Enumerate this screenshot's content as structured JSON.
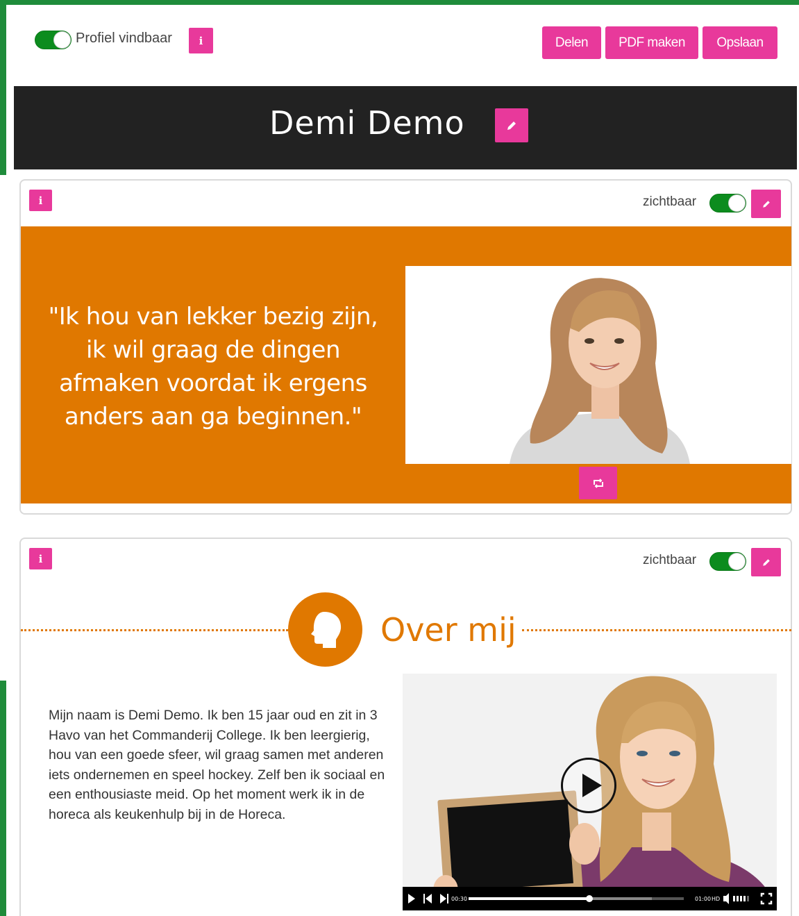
{
  "topbar": {
    "profile_label": "Profiel vindbaar",
    "info_glyph": "i",
    "buttons": {
      "share": "Delen",
      "pdf": "PDF maken",
      "save": "Opslaan"
    }
  },
  "header": {
    "name": "Demi Demo"
  },
  "quote_card": {
    "visibility_label": "zichtbaar",
    "quote": "\"Ik hou van lekker bezig zijn, ik wil graag de dingen afmaken voordat ik ergens anders aan ga beginnen.\""
  },
  "about_card": {
    "visibility_label": "zichtbaar",
    "title": "Over mij",
    "text": "Mijn naam is Demi Demo. Ik ben 15 jaar oud en zit in 3 Havo van het Commanderij College. Ik ben leergierig, hou van een goede sfeer, wil graag samen met anderen iets ondernemen en speel hockey. Zelf ben ik sociaal en een enthousiaste meid. Op het moment werk ik in de horeca als keukenhulp bij in de Horeca.",
    "video": {
      "current_time": "00:30",
      "duration": "01:00",
      "quality": "HD",
      "progress": 0.56,
      "buffered": 0.85
    }
  },
  "colors": {
    "pink": "#e8399b",
    "orange": "#e07800",
    "green": "#1f8c3b",
    "dark": "#222222"
  }
}
